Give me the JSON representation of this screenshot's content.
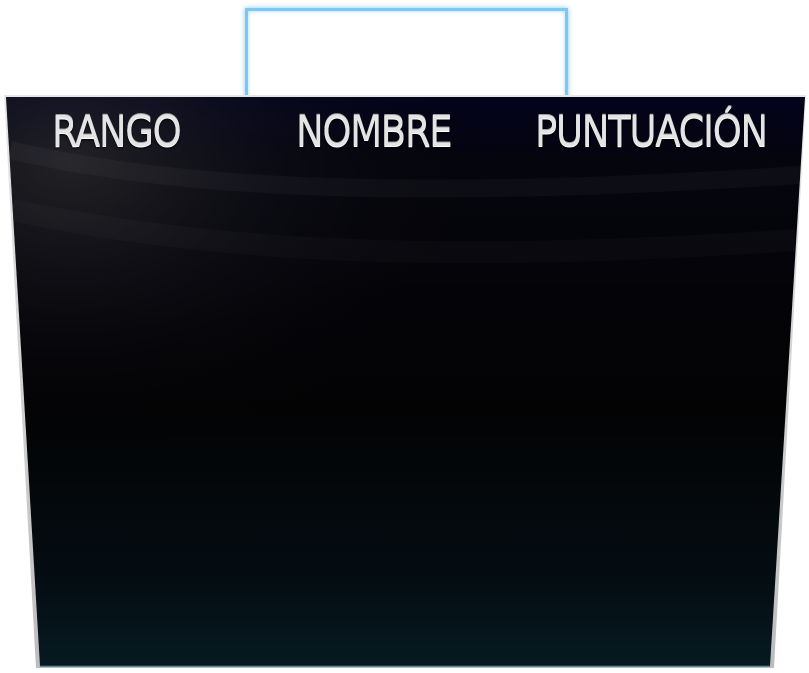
{
  "leaderboard": {
    "headers": {
      "rank": "RANGO",
      "name": "NOMBRE",
      "score": "PUNTUACIÓN"
    },
    "entries": []
  },
  "colors": {
    "board_top": "#03031a",
    "board_mid": "#030305",
    "board_bottom": "#06191f",
    "tab_border": "#7cc8f2",
    "header_text": "#e4e4e4",
    "board_edge": "#c8c8c8"
  }
}
